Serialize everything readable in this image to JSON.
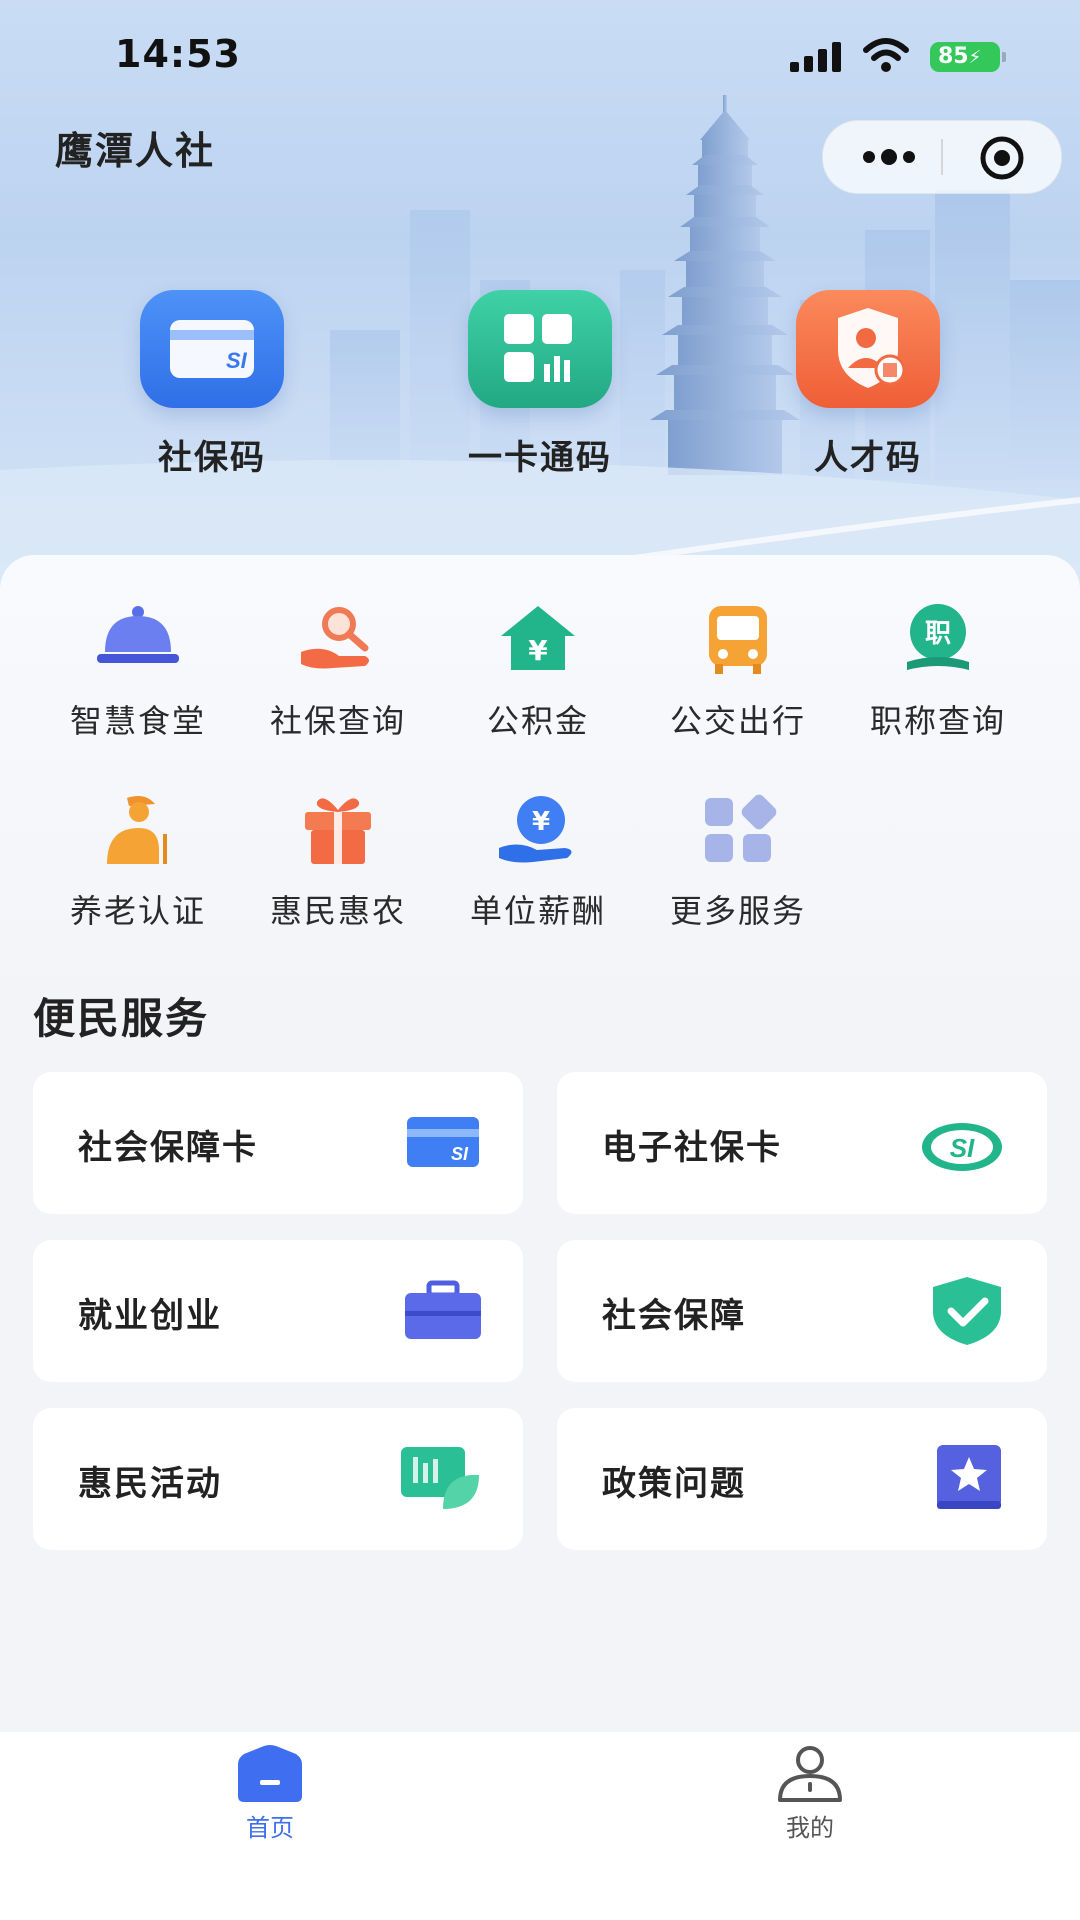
{
  "status_bar": {
    "time": "14:53",
    "battery": "85"
  },
  "header": {
    "app_title": "鹰潭人社",
    "more_icon": "more-dots-icon",
    "target_icon": "target-icon"
  },
  "codes": [
    {
      "label": "社保码",
      "icon": "social-security-card-icon",
      "color": "#3f7ff3"
    },
    {
      "label": "一卡通码",
      "icon": "grid-chart-icon",
      "color": "#2fbf94"
    },
    {
      "label": "人才码",
      "icon": "shield-person-icon",
      "color": "#f36b45"
    }
  ],
  "services": [
    {
      "label": "智慧食堂",
      "icon": "food-cloche-icon"
    },
    {
      "label": "社保查询",
      "icon": "hand-magnifier-icon"
    },
    {
      "label": "公积金",
      "icon": "house-yuan-icon"
    },
    {
      "label": "公交出行",
      "icon": "bus-icon"
    },
    {
      "label": "职称查询",
      "icon": "title-badge-icon"
    },
    {
      "label": "养老认证",
      "icon": "elderly-person-icon"
    },
    {
      "label": "惠民惠农",
      "icon": "gift-icon"
    },
    {
      "label": "单位薪酬",
      "icon": "hand-yuan-coin-icon"
    },
    {
      "label": "更多服务",
      "icon": "more-apps-icon"
    }
  ],
  "convenience": {
    "title": "便民服务",
    "cards": [
      {
        "label": "社会保障卡",
        "icon": "social-security-card-icon"
      },
      {
        "label": "电子社保卡",
        "icon": "si-logo-icon"
      },
      {
        "label": "就业创业",
        "icon": "briefcase-icon"
      },
      {
        "label": "社会保障",
        "icon": "shield-check-icon"
      },
      {
        "label": "惠民活动",
        "icon": "leaf-chart-icon"
      },
      {
        "label": "政策问题",
        "icon": "star-book-icon"
      }
    ]
  },
  "tabbar": {
    "tabs": [
      {
        "label": "首页",
        "icon": "home-icon",
        "active": true
      },
      {
        "label": "我的",
        "icon": "person-icon",
        "active": false
      }
    ],
    "active_color": "#3f6ff0",
    "inactive_color": "#555555"
  }
}
